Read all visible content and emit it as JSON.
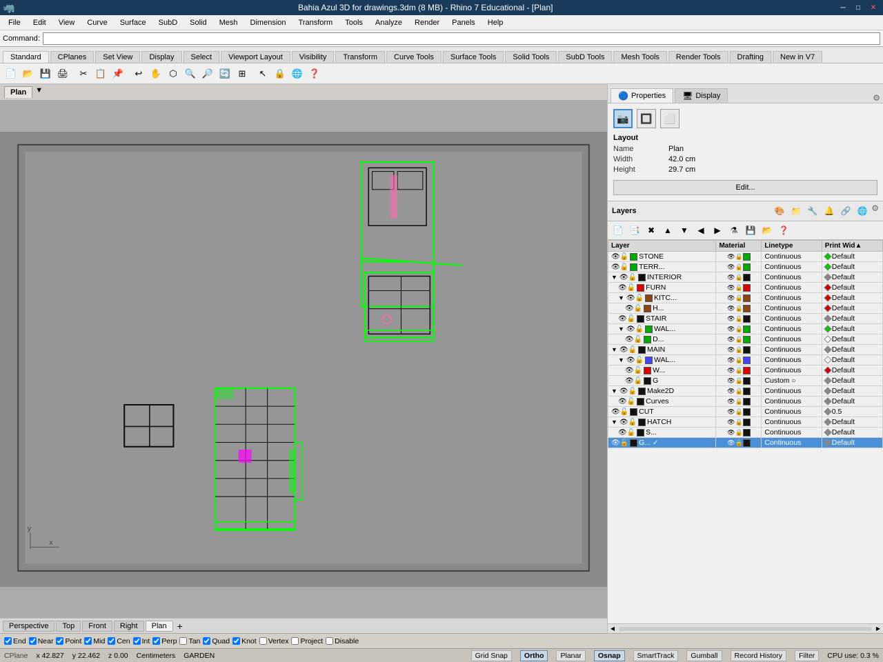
{
  "titlebar": {
    "title": "Bahia Azul 3D for drawings.3dm (8 MB) - Rhino 7 Educational - [Plan]",
    "minimize": "─",
    "maximize": "□",
    "close": "✕"
  },
  "menubar": {
    "items": [
      "File",
      "Edit",
      "View",
      "Curve",
      "Surface",
      "SubD",
      "Solid",
      "Mesh",
      "Dimension",
      "Transform",
      "Tools",
      "Analyze",
      "Render",
      "Panels",
      "Help"
    ]
  },
  "command": {
    "label": "Command:",
    "placeholder": ""
  },
  "toolbar_tabs": {
    "tabs": [
      "Standard",
      "CPlanes",
      "Set View",
      "Display",
      "Select",
      "Viewport Layout",
      "Visibility",
      "Transform",
      "Curve Tools",
      "Surface Tools",
      "Solid Tools",
      "SubD Tools",
      "Mesh Tools",
      "Render Tools",
      "Drafting",
      "New in V7"
    ]
  },
  "viewport": {
    "tab_label": "Plan",
    "dropdown": "▼"
  },
  "view_tabs": {
    "tabs": [
      "Perspective",
      "Top",
      "Front",
      "Right",
      "Plan"
    ],
    "active": "Plan",
    "add": "+"
  },
  "properties_panel": {
    "tab_label": "Properties",
    "icon1": "📷",
    "icon2": "🔲",
    "icon3": "⬜",
    "section": "Layout",
    "fields": [
      {
        "label": "Name",
        "value": "Plan"
      },
      {
        "label": "Width",
        "value": "42.0 cm"
      },
      {
        "label": "Height",
        "value": "29.7 cm"
      }
    ],
    "edit_button": "Edit..."
  },
  "layers_panel": {
    "title": "Layers",
    "columns": [
      "Layer",
      "Material",
      "Linetype",
      "Print Wid"
    ],
    "layers": [
      {
        "name": "STONE",
        "indent": 0,
        "visible": true,
        "locked": false,
        "color": "#00aa00",
        "linetype": "Continuous",
        "print_width": "Default",
        "print_color": "green"
      },
      {
        "name": "TERR...",
        "indent": 0,
        "visible": true,
        "locked": false,
        "color": "#00aa00",
        "linetype": "Continuous",
        "print_width": "Default",
        "print_color": "green"
      },
      {
        "name": "INTERIOR",
        "indent": 0,
        "visible": true,
        "locked": false,
        "color": "#111111",
        "linetype": "Continuous",
        "print_width": "Default",
        "print_color": "gray",
        "expandable": true,
        "expanded": true
      },
      {
        "name": "FURN",
        "indent": 1,
        "visible": true,
        "locked": false,
        "color": "#dd0000",
        "linetype": "Continuous",
        "print_width": "Default",
        "print_color": "red"
      },
      {
        "name": "KITC...",
        "indent": 1,
        "visible": true,
        "locked": false,
        "color": "#8B4513",
        "linetype": "Continuous",
        "print_width": "Default",
        "print_color": "red",
        "expandable": true,
        "expanded": true
      },
      {
        "name": "H...",
        "indent": 2,
        "visible": true,
        "locked": false,
        "color": "#8B4513",
        "linetype": "Continuous",
        "print_width": "Default",
        "print_color": "red"
      },
      {
        "name": "STAIR",
        "indent": 1,
        "visible": true,
        "locked": false,
        "color": "#111111",
        "linetype": "Continuous",
        "print_width": "Default",
        "print_color": "gray"
      },
      {
        "name": "WAL...",
        "indent": 1,
        "visible": true,
        "locked": false,
        "color": "#00aa00",
        "linetype": "Continuous",
        "print_width": "Default",
        "print_color": "green",
        "expandable": true,
        "expanded": true
      },
      {
        "name": "D...",
        "indent": 2,
        "visible": true,
        "locked": false,
        "color": "#00aa00",
        "linetype": "Continuous",
        "print_width": "Default",
        "print_color": "white"
      },
      {
        "name": "MAIN",
        "indent": 0,
        "visible": true,
        "locked": false,
        "color": "#111111",
        "linetype": "Continuous",
        "print_width": "Default",
        "print_color": "gray",
        "expandable": true,
        "expanded": true
      },
      {
        "name": "WAL...",
        "indent": 1,
        "visible": true,
        "locked": false,
        "color": "#4444ff",
        "linetype": "Continuous",
        "print_width": "Default",
        "print_color": "white",
        "expandable": true,
        "expanded": true
      },
      {
        "name": "W...",
        "indent": 2,
        "visible": true,
        "locked": false,
        "color": "#dd0000",
        "linetype": "Continuous",
        "print_width": "Default",
        "print_color": "red"
      },
      {
        "name": "G",
        "indent": 2,
        "visible": true,
        "locked": false,
        "color": "#111111",
        "linetype": "Custom",
        "print_width": "Default",
        "print_color": "gray",
        "custom_linetype": true
      },
      {
        "name": "Make2D",
        "indent": 0,
        "visible": true,
        "locked": false,
        "color": "#111111",
        "linetype": "Continuous",
        "print_width": "Default",
        "print_color": "gray",
        "expandable": true,
        "expanded": true
      },
      {
        "name": "Curves",
        "indent": 1,
        "visible": true,
        "locked": false,
        "color": "#111111",
        "linetype": "Continuous",
        "print_width": "Default",
        "print_color": "gray"
      },
      {
        "name": "CUT",
        "indent": 0,
        "visible": true,
        "locked": false,
        "color": "#111111",
        "linetype": "Continuous",
        "print_width": "0.5",
        "print_color": "gray"
      },
      {
        "name": "HATCH",
        "indent": 0,
        "visible": true,
        "locked": false,
        "color": "#111111",
        "linetype": "Continuous",
        "print_width": "Default",
        "print_color": "gray",
        "expandable": true,
        "expanded": true
      },
      {
        "name": "S...",
        "indent": 1,
        "visible": true,
        "locked": false,
        "color": "#111111",
        "linetype": "Continuous",
        "print_width": "Default",
        "print_color": "gray"
      },
      {
        "name": "G...",
        "indent": 0,
        "visible": true,
        "locked": false,
        "color": "#111111",
        "linetype": "Continuous",
        "print_width": "Default",
        "print_color": "gray",
        "selected": true,
        "checked": true
      }
    ]
  },
  "statusbar": {
    "cplane": "CPlane",
    "x": "x 42.827",
    "y": "y 22.462",
    "z": "z 0.00",
    "units": "Centimeters",
    "layer": "GARDEN",
    "grid_snap": "Grid Snap",
    "ortho": "Ortho",
    "planar": "Planar",
    "osnap": "Osnap",
    "smarttrack": "SmartTrack",
    "gumball": "Gumball",
    "record_history": "Record History",
    "filter": "Filter",
    "cpu": "CPU use: 0.3 %"
  },
  "osnap_bar": {
    "items": [
      {
        "label": "End",
        "checked": true
      },
      {
        "label": "Near",
        "checked": true
      },
      {
        "label": "Point",
        "checked": true
      },
      {
        "label": "Mid",
        "checked": true
      },
      {
        "label": "Cen",
        "checked": true
      },
      {
        "label": "Int",
        "checked": true
      },
      {
        "label": "Perp",
        "checked": true
      },
      {
        "label": "Tan",
        "checked": false
      },
      {
        "label": "Quad",
        "checked": true
      },
      {
        "label": "Knot",
        "checked": true
      },
      {
        "label": "Vertex",
        "checked": false
      },
      {
        "label": "Project",
        "checked": false
      },
      {
        "label": "Disable",
        "checked": false
      }
    ]
  }
}
